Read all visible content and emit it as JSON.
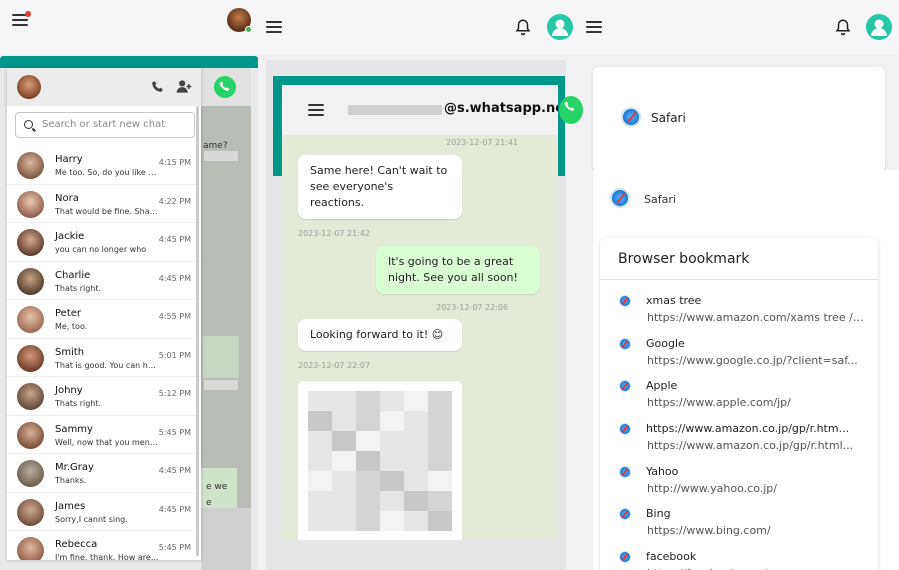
{
  "header": {
    "icons": [
      "menu-icon",
      "notification-icon",
      "bell-icon",
      "avatar"
    ]
  },
  "chat_list": {
    "search_placeholder": "Search or start new chat",
    "items": [
      {
        "name": "Harry",
        "message": "Me too. So, do you like th...",
        "time": "4:15 PM"
      },
      {
        "name": "Nora",
        "message": "That would be fine. Shall...",
        "time": "4:22 PM"
      },
      {
        "name": "Jackie",
        "message": "you can no longer who",
        "time": "4:45 PM"
      },
      {
        "name": "Charlie",
        "message": "Thats right.",
        "time": "4:45 PM"
      },
      {
        "name": "Peter",
        "message": "Me, too.",
        "time": "4:55 PM"
      },
      {
        "name": "Smith",
        "message": "That is good. You can ha...",
        "time": "5:01 PM"
      },
      {
        "name": "Johny",
        "message": "Thats right.",
        "time": "5:12 PM"
      },
      {
        "name": "Sammy",
        "message": "Well, now that you ment...",
        "time": "5:45 PM"
      },
      {
        "name": "Mr.Gray",
        "message": "Thanks.",
        "time": "4:45 PM"
      },
      {
        "name": "James",
        "message": "Sorry,I cannt sing.",
        "time": "4:45 PM"
      },
      {
        "name": "Rebecca",
        "message": "I'm fine, thank. How are...",
        "time": "5:45 PM"
      }
    ],
    "peek_text_1": "ame?",
    "peek_text_2": "e we",
    "peek_text_3": "e"
  },
  "whatsapp_chat": {
    "title": "@s.whatsapp.net",
    "top_timestamp": "2023-12-07 21:41",
    "messages": [
      {
        "dir": "in",
        "text": "Same here! Can't wait to see everyone's reactions.",
        "time": "2023-12-07 21:42"
      },
      {
        "dir": "out",
        "text": "It's going to be a great night. See you all soon!",
        "time": "2023-12-07 22:06"
      },
      {
        "dir": "in",
        "text": "Looking forward to it! 😊",
        "time": "2023-12-07 22:07"
      }
    ]
  },
  "browser": {
    "card_title": "Safari",
    "app_label": "Safari",
    "bookmark_title": "Browser bookmark",
    "bookmarks": [
      {
        "title": "xmas tree",
        "url": "https://www.amazon.com/xams tree /450..."
      },
      {
        "title": "Google",
        "url": "https://www.google.co.jp/?client=saf..."
      },
      {
        "title": "Apple",
        "url": "https://www.apple.com/jp/"
      },
      {
        "title": "https://www.amazon.co.jp/gp/r.htm...",
        "url": "https://www.amazon.co.jp/gp/r.html..."
      },
      {
        "title": "Yahoo",
        "url": "http://www.yahoo.co.jp/"
      },
      {
        "title": "Bing",
        "url": "https://www.bing.com/"
      },
      {
        "title": "facebook",
        "url": "https://facebook.com/..."
      }
    ]
  },
  "colors": {
    "teal": "#009688",
    "whatsapp_green": "#25d366",
    "out_bubble": "#d9fdd3"
  }
}
